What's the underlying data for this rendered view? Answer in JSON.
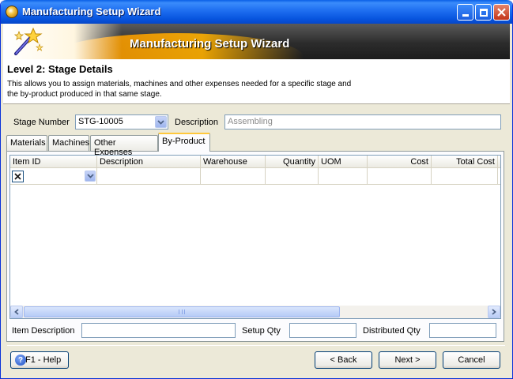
{
  "window": {
    "title": "Manufacturing Setup Wizard"
  },
  "banner": {
    "title": "Manufacturing Setup Wizard"
  },
  "header": {
    "level_title": "Level 2: Stage Details",
    "description": "This allows you to assign materials, machines and other expenses needed for a specific stage and the by-product produced in that same stage."
  },
  "stage": {
    "number_label": "Stage Number",
    "number_value": "STG-10005",
    "description_label": "Description",
    "description_value": "Assembling"
  },
  "tabs": [
    {
      "label": "Materials",
      "active": false
    },
    {
      "label": "Machines",
      "active": false
    },
    {
      "label": "Other Expenses",
      "active": false
    },
    {
      "label": "By-Product",
      "active": true
    }
  ],
  "grid": {
    "columns": [
      "Item ID",
      "Description",
      "Warehouse",
      "Quantity",
      "UOM",
      "Cost",
      "Total Cost"
    ],
    "rows": [
      {
        "item_id": "",
        "description": "",
        "warehouse": "",
        "quantity": "",
        "uom": "",
        "cost": "",
        "total_cost": ""
      }
    ]
  },
  "footer_fields": {
    "item_description_label": "Item Description",
    "item_description_value": "",
    "setup_qty_label": "Setup Qty",
    "setup_qty_value": "",
    "distributed_qty_label": "Distributed Qty",
    "distributed_qty_value": ""
  },
  "buttons": {
    "help": "F1 - Help",
    "back": "< Back",
    "next": "Next >",
    "cancel": "Cancel"
  },
  "colors": {
    "titlebar": "#0754DE",
    "active_tab_accent": "#FFC83C",
    "banner_accent": "#F08A00"
  }
}
